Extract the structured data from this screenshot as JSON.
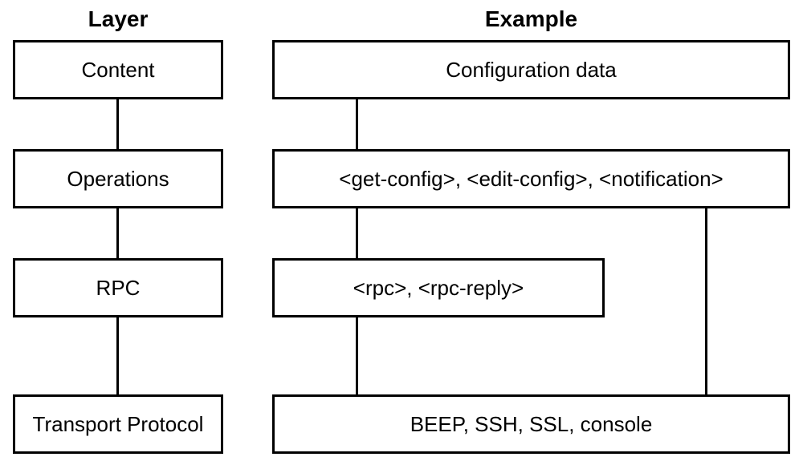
{
  "headers": {
    "layer": "Layer",
    "example": "Example"
  },
  "layers": {
    "content": "Content",
    "operations": "Operations",
    "rpc": "RPC",
    "transport": "Transport Protocol"
  },
  "examples": {
    "content": "Configuration data",
    "operations": "<get-config>, <edit-config>, <notification>",
    "rpc": "<rpc>, <rpc-reply>",
    "transport": "BEEP, SSH, SSL, console"
  }
}
